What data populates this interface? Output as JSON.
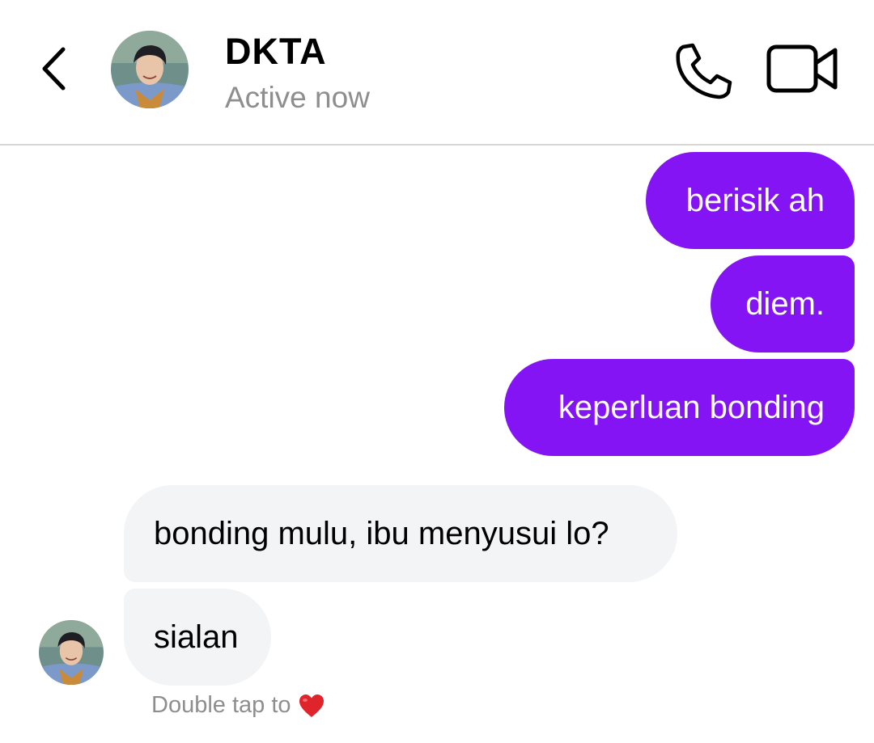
{
  "header": {
    "contact_name": "DKTA",
    "status": "Active now"
  },
  "messages": [
    {
      "direction": "outgoing",
      "text": "berisik ah"
    },
    {
      "direction": "outgoing",
      "text": "diem."
    },
    {
      "direction": "outgoing",
      "text": "keperluan bonding"
    },
    {
      "direction": "incoming",
      "text": "bonding mulu, ibu menyusui lo?"
    },
    {
      "direction": "incoming",
      "text": "sialan"
    }
  ],
  "reaction_hint": {
    "text": "Double tap to",
    "icon": "heart-icon"
  },
  "colors": {
    "outgoing_bubble": "#8514f5",
    "incoming_bubble": "#f3f4f6",
    "muted_text": "#8e8e8e",
    "heart": "#e0242b"
  },
  "icons": {
    "back": "chevron-left-icon",
    "call": "phone-icon",
    "video": "video-camera-icon"
  }
}
